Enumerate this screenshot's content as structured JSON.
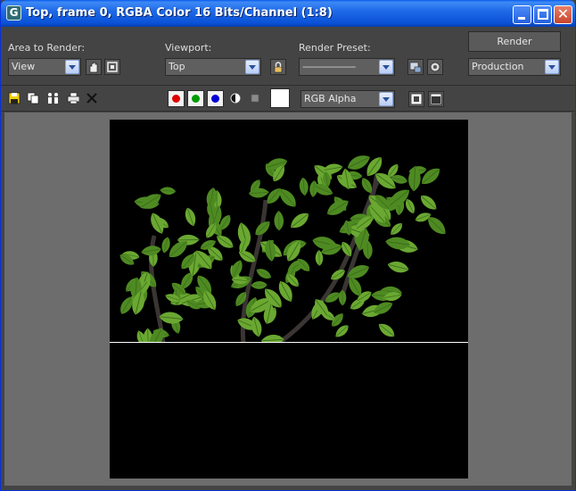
{
  "window": {
    "title": "Top, frame 0, RGBA Color 16 Bits/Channel (1:8)",
    "app_icon_letter": "G",
    "colors": {
      "titlebar": "#0a52d8",
      "close": "#c7442a",
      "panel": "#444444",
      "frame_bg": "#6d6d6d"
    }
  },
  "controls": {
    "area_label": "Area to Render:",
    "area_value": "View",
    "viewport_label": "Viewport:",
    "viewport_value": "Top",
    "preset_label": "Render Preset:",
    "preset_value": "--------------------",
    "render_button": "Render",
    "mode_value": "Production"
  },
  "toolbar": {
    "channel_value": "RGB Alpha",
    "icons": [
      "save-icon",
      "copy-icon",
      "clone-icon",
      "print-icon",
      "clear-icon",
      "red-channel-icon",
      "green-channel-icon",
      "blue-channel-icon",
      "alpha-toggle-icon",
      "mono-icon",
      "color-swatch",
      "display-icon-1",
      "display-icon-2"
    ],
    "colors": {
      "red": "#e00000",
      "green": "#009a00",
      "blue": "#0000d8"
    }
  },
  "render": {
    "progress_fraction": 0.62,
    "colors": {
      "leaf": "#6aa832",
      "leaf_dark": "#4e8a22",
      "branch": "#3a3533"
    }
  }
}
